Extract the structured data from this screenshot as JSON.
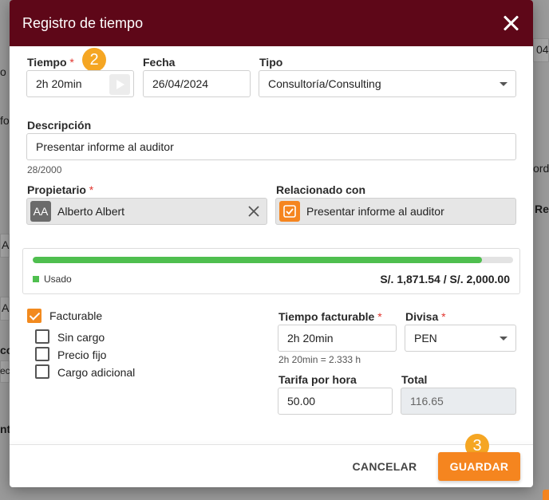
{
  "dialog": {
    "title": "Registro de tiempo",
    "close_label": "",
    "accent": "#5e0718"
  },
  "background": {
    "frag_top_right": "04",
    "frag_o": "o",
    "frag_fo": "fo",
    "frag_ord": "ord",
    "frag_re": "Re",
    "frag_a1": "A",
    "frag_a2": "A",
    "frag_co": "co",
    "frag_ec": "ec",
    "frag_nt": "nt"
  },
  "form": {
    "tiempo": {
      "label": "Tiempo",
      "required": "*",
      "value": "2h 20min"
    },
    "fecha": {
      "label": "Fecha",
      "value": "26/04/2024"
    },
    "tipo": {
      "label": "Tipo",
      "value": "Consultoría/Consulting"
    },
    "descripcion": {
      "label": "Descripción",
      "value": "Presentar informe al auditor",
      "counter": "28/2000"
    },
    "propietario": {
      "label": "Propietario",
      "required": "*",
      "initials": "AA",
      "value": "Alberto Albert"
    },
    "relacionado": {
      "label": "Relacionado con",
      "value": "Presentar informe al auditor"
    }
  },
  "usage": {
    "legend": "Usado",
    "amount": "S/. 1,871.54 / S/. 2,000.00",
    "used": 1871.54,
    "total": 2000.0
  },
  "billing": {
    "facturable": {
      "label": "Facturable",
      "checked": true
    },
    "sin_cargo": {
      "label": "Sin cargo",
      "checked": false
    },
    "precio_fijo": {
      "label": "Precio fijo",
      "checked": false
    },
    "cargo_adicional": {
      "label": "Cargo adicional",
      "checked": false
    },
    "tiempo_facturable": {
      "label": "Tiempo facturable",
      "required": "*",
      "value": "2h 20min",
      "hint": "2h 20min = 2.333 h"
    },
    "divisa": {
      "label": "Divisa",
      "required": "*",
      "value": "PEN"
    },
    "tarifa": {
      "label": "Tarifa por hora",
      "value": "50.00"
    },
    "total": {
      "label": "Total",
      "value": "116.65"
    }
  },
  "badges": {
    "step2": "2",
    "step3": "3"
  },
  "actions": {
    "cancel": "CANCELAR",
    "save": "GUARDAR"
  },
  "colors": {
    "primary_orange": "#f5851f",
    "progress_green": "#4fbf4f",
    "required_red": "#e2352e"
  }
}
